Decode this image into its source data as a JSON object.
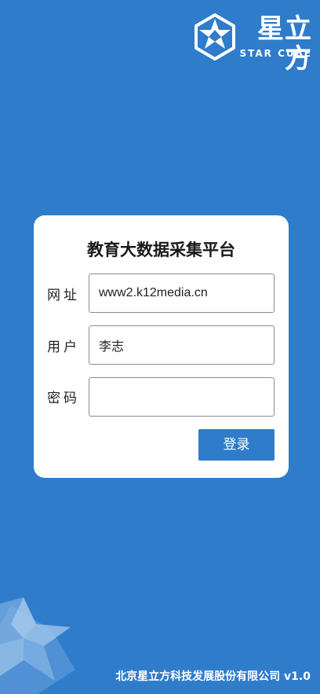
{
  "logo": {
    "cn_text": "星立方",
    "en_text": "STAR CUBE"
  },
  "login": {
    "title": "教育大数据采集平台",
    "fields": {
      "url": {
        "label": "网址",
        "value": "www2.k12media.cn"
      },
      "user": {
        "label": "用户",
        "value": "李志"
      },
      "password": {
        "label": "密码",
        "value": ""
      }
    },
    "submit_label": "登录"
  },
  "footer": {
    "text": "北京星立方科技发展股份有限公司 v1.0"
  },
  "colors": {
    "background": "#2f7ccb",
    "card": "#ffffff",
    "button": "#2f7ccb"
  },
  "icons": {
    "logo": "star-cube-logo-icon",
    "decoration": "star-cube-decoration-icon"
  }
}
